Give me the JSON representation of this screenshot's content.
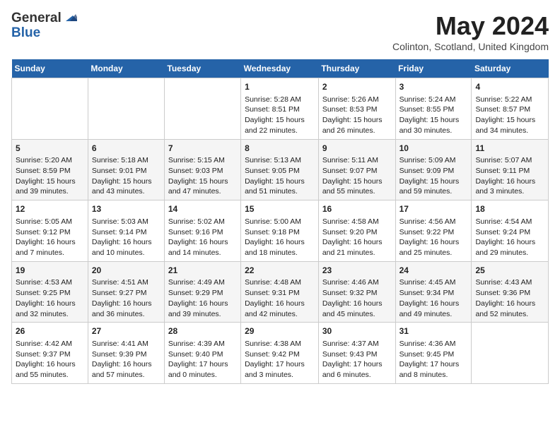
{
  "header": {
    "logo_line1": "General",
    "logo_line2": "Blue",
    "month_title": "May 2024",
    "location": "Colinton, Scotland, United Kingdom"
  },
  "days_of_week": [
    "Sunday",
    "Monday",
    "Tuesday",
    "Wednesday",
    "Thursday",
    "Friday",
    "Saturday"
  ],
  "weeks": [
    [
      {
        "day": "",
        "info": ""
      },
      {
        "day": "",
        "info": ""
      },
      {
        "day": "",
        "info": ""
      },
      {
        "day": "1",
        "info": "Sunrise: 5:28 AM\nSunset: 8:51 PM\nDaylight: 15 hours\nand 22 minutes."
      },
      {
        "day": "2",
        "info": "Sunrise: 5:26 AM\nSunset: 8:53 PM\nDaylight: 15 hours\nand 26 minutes."
      },
      {
        "day": "3",
        "info": "Sunrise: 5:24 AM\nSunset: 8:55 PM\nDaylight: 15 hours\nand 30 minutes."
      },
      {
        "day": "4",
        "info": "Sunrise: 5:22 AM\nSunset: 8:57 PM\nDaylight: 15 hours\nand 34 minutes."
      }
    ],
    [
      {
        "day": "5",
        "info": "Sunrise: 5:20 AM\nSunset: 8:59 PM\nDaylight: 15 hours\nand 39 minutes."
      },
      {
        "day": "6",
        "info": "Sunrise: 5:18 AM\nSunset: 9:01 PM\nDaylight: 15 hours\nand 43 minutes."
      },
      {
        "day": "7",
        "info": "Sunrise: 5:15 AM\nSunset: 9:03 PM\nDaylight: 15 hours\nand 47 minutes."
      },
      {
        "day": "8",
        "info": "Sunrise: 5:13 AM\nSunset: 9:05 PM\nDaylight: 15 hours\nand 51 minutes."
      },
      {
        "day": "9",
        "info": "Sunrise: 5:11 AM\nSunset: 9:07 PM\nDaylight: 15 hours\nand 55 minutes."
      },
      {
        "day": "10",
        "info": "Sunrise: 5:09 AM\nSunset: 9:09 PM\nDaylight: 15 hours\nand 59 minutes."
      },
      {
        "day": "11",
        "info": "Sunrise: 5:07 AM\nSunset: 9:11 PM\nDaylight: 16 hours\nand 3 minutes."
      }
    ],
    [
      {
        "day": "12",
        "info": "Sunrise: 5:05 AM\nSunset: 9:12 PM\nDaylight: 16 hours\nand 7 minutes."
      },
      {
        "day": "13",
        "info": "Sunrise: 5:03 AM\nSunset: 9:14 PM\nDaylight: 16 hours\nand 10 minutes."
      },
      {
        "day": "14",
        "info": "Sunrise: 5:02 AM\nSunset: 9:16 PM\nDaylight: 16 hours\nand 14 minutes."
      },
      {
        "day": "15",
        "info": "Sunrise: 5:00 AM\nSunset: 9:18 PM\nDaylight: 16 hours\nand 18 minutes."
      },
      {
        "day": "16",
        "info": "Sunrise: 4:58 AM\nSunset: 9:20 PM\nDaylight: 16 hours\nand 21 minutes."
      },
      {
        "day": "17",
        "info": "Sunrise: 4:56 AM\nSunset: 9:22 PM\nDaylight: 16 hours\nand 25 minutes."
      },
      {
        "day": "18",
        "info": "Sunrise: 4:54 AM\nSunset: 9:24 PM\nDaylight: 16 hours\nand 29 minutes."
      }
    ],
    [
      {
        "day": "19",
        "info": "Sunrise: 4:53 AM\nSunset: 9:25 PM\nDaylight: 16 hours\nand 32 minutes."
      },
      {
        "day": "20",
        "info": "Sunrise: 4:51 AM\nSunset: 9:27 PM\nDaylight: 16 hours\nand 36 minutes."
      },
      {
        "day": "21",
        "info": "Sunrise: 4:49 AM\nSunset: 9:29 PM\nDaylight: 16 hours\nand 39 minutes."
      },
      {
        "day": "22",
        "info": "Sunrise: 4:48 AM\nSunset: 9:31 PM\nDaylight: 16 hours\nand 42 minutes."
      },
      {
        "day": "23",
        "info": "Sunrise: 4:46 AM\nSunset: 9:32 PM\nDaylight: 16 hours\nand 45 minutes."
      },
      {
        "day": "24",
        "info": "Sunrise: 4:45 AM\nSunset: 9:34 PM\nDaylight: 16 hours\nand 49 minutes."
      },
      {
        "day": "25",
        "info": "Sunrise: 4:43 AM\nSunset: 9:36 PM\nDaylight: 16 hours\nand 52 minutes."
      }
    ],
    [
      {
        "day": "26",
        "info": "Sunrise: 4:42 AM\nSunset: 9:37 PM\nDaylight: 16 hours\nand 55 minutes."
      },
      {
        "day": "27",
        "info": "Sunrise: 4:41 AM\nSunset: 9:39 PM\nDaylight: 16 hours\nand 57 minutes."
      },
      {
        "day": "28",
        "info": "Sunrise: 4:39 AM\nSunset: 9:40 PM\nDaylight: 17 hours\nand 0 minutes."
      },
      {
        "day": "29",
        "info": "Sunrise: 4:38 AM\nSunset: 9:42 PM\nDaylight: 17 hours\nand 3 minutes."
      },
      {
        "day": "30",
        "info": "Sunrise: 4:37 AM\nSunset: 9:43 PM\nDaylight: 17 hours\nand 6 minutes."
      },
      {
        "day": "31",
        "info": "Sunrise: 4:36 AM\nSunset: 9:45 PM\nDaylight: 17 hours\nand 8 minutes."
      },
      {
        "day": "",
        "info": ""
      }
    ]
  ]
}
